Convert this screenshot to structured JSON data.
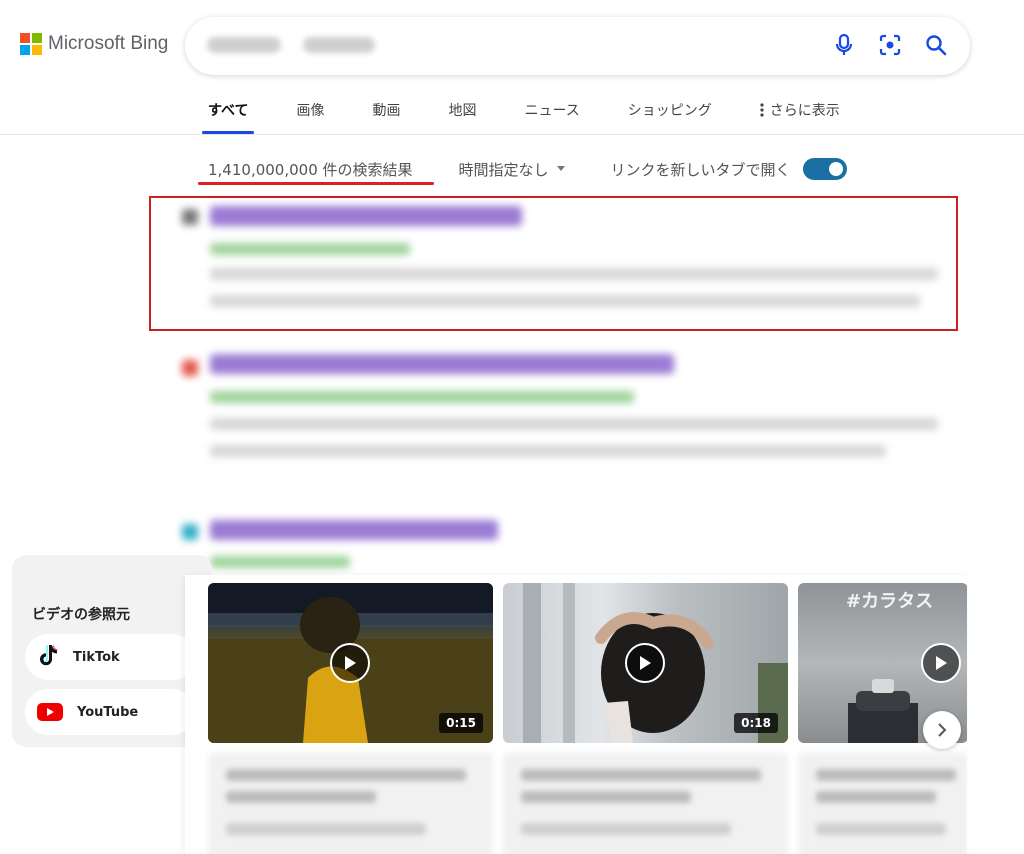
{
  "brand": {
    "name": "Microsoft Bing",
    "colors": [
      "#f25022",
      "#7fba00",
      "#00a4ef",
      "#ffb900"
    ]
  },
  "search": {
    "icons": [
      "microphone-icon",
      "visual-search-icon",
      "search-icon"
    ],
    "accent": "#174ae4"
  },
  "tabs": {
    "all": "すべて",
    "images": "画像",
    "videos": "動画",
    "maps": "地図",
    "news": "ニュース",
    "shopping": "ショッピング",
    "more": "さらに表示"
  },
  "infobar": {
    "result_count": "1,410,000,000 件の検索結果",
    "time_filter": "時間指定なし",
    "new_tab_label": "リンクを新しいタブで開く",
    "new_tab_enabled": true
  },
  "video_sources": {
    "title": "ビデオの参照元",
    "items": [
      {
        "label": "TikTok",
        "icon": "tiktok-icon"
      },
      {
        "label": "YouTube",
        "icon": "youtube-icon"
      }
    ]
  },
  "videos": [
    {
      "duration": "0:15"
    },
    {
      "duration": "0:18"
    },
    {
      "overlay_text": "#カラタス"
    }
  ],
  "annotations": {
    "highlight_color": "#cc1f1f"
  }
}
